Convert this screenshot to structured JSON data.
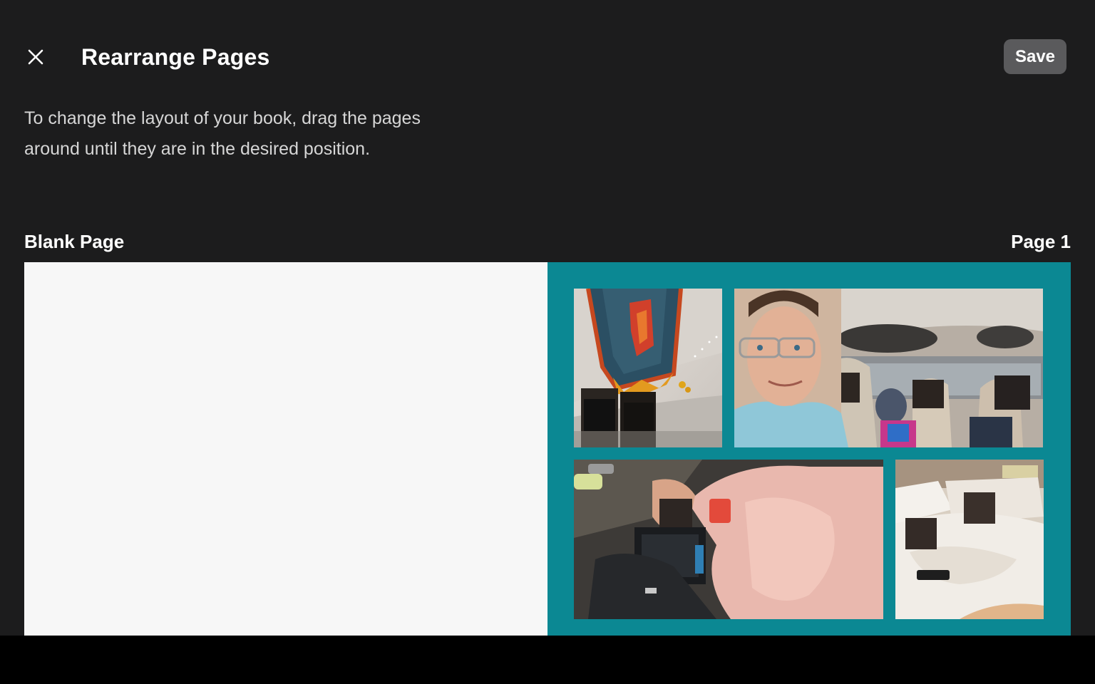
{
  "header": {
    "close_icon": "close-icon",
    "title": "Rearrange Pages",
    "save_label": "Save"
  },
  "instructions": "To change the layout of your book, drag the pages around until they are in the desired position.",
  "pages": {
    "left_label": "Blank Page",
    "right_label": "Page 1"
  },
  "colors": {
    "background": "#1c1c1d",
    "save_button": "#5a5a5c",
    "page_one_background": "#0b8893",
    "blank_page": "#f7f7f7"
  },
  "photos": [
    {
      "description_icon": "photo-thumbnail"
    },
    {
      "description_icon": "photo-thumbnail"
    },
    {
      "description_icon": "photo-thumbnail"
    },
    {
      "description_icon": "photo-thumbnail"
    }
  ]
}
